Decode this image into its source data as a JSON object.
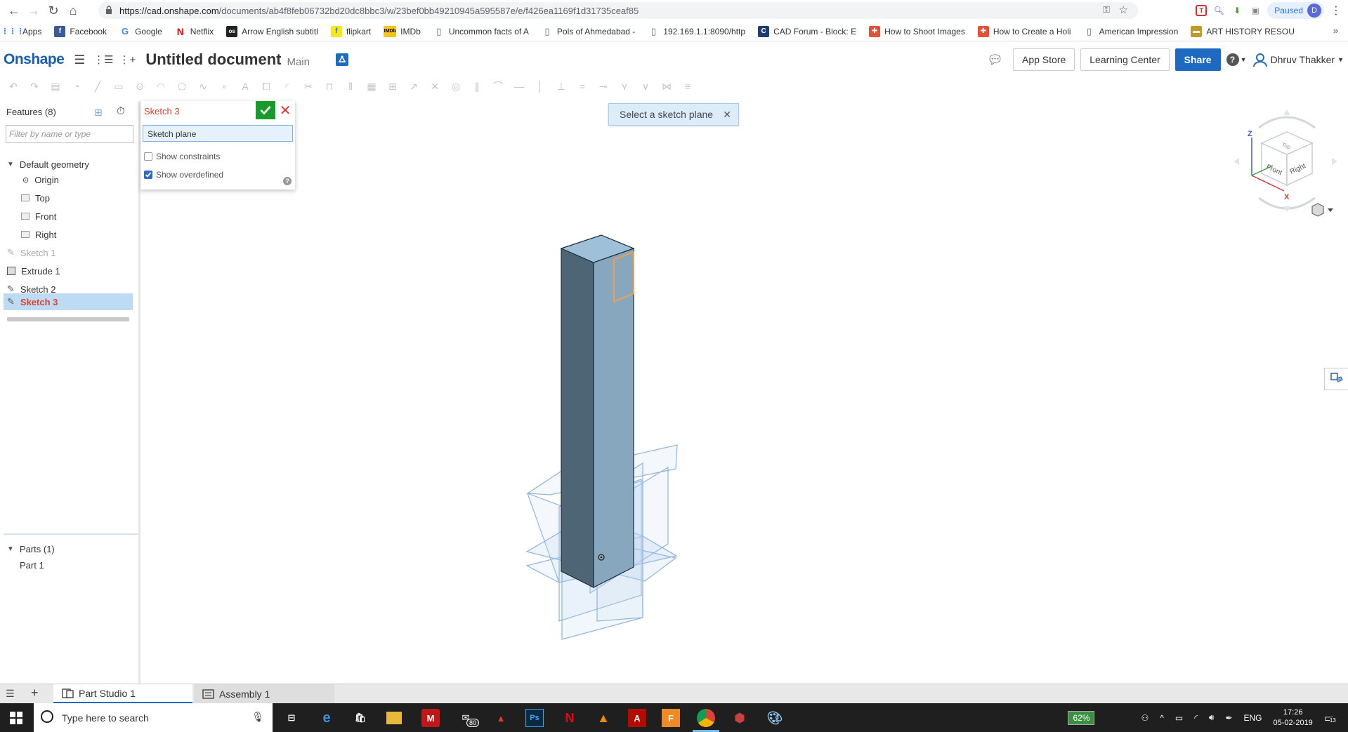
{
  "browser": {
    "url_host": "https://cad.onshape.com",
    "url_rest": "/documents/ab4f8feb06732bd20dc8bbc3/w/23bef0bb49210945a595587e/e/f426ea1169f1d31735ceaf85",
    "paused_label": "Paused",
    "profile_initial": "D"
  },
  "bookmarks": [
    {
      "label": "Apps",
      "color": "#4285f4",
      "glyph": "⋮⋮"
    },
    {
      "label": "Facebook",
      "color": "#3b5998",
      "glyph": "f"
    },
    {
      "label": "Google",
      "color": "#ffffff",
      "glyph": "G"
    },
    {
      "label": "Netflix",
      "color": "#e50914",
      "glyph": "N"
    },
    {
      "label": "Arrow English subtitl",
      "color": "#222222",
      "glyph": "os"
    },
    {
      "label": "flipkart",
      "color": "#f8e71c",
      "glyph": "f"
    },
    {
      "label": "IMDb",
      "color": "#f5c518",
      "glyph": "IMDb"
    },
    {
      "label": "Uncommon facts of A",
      "color": "#ffffff",
      "glyph": "▯"
    },
    {
      "label": "Pols of Ahmedabad -",
      "color": "#ffffff",
      "glyph": "▯"
    },
    {
      "label": "192.169.1.1:8090/http",
      "color": "#ffffff",
      "glyph": "▯"
    },
    {
      "label": "CAD Forum - Block: E",
      "color": "#1f3b73",
      "glyph": "C"
    },
    {
      "label": "How to Shoot Images",
      "color": "#e0533a",
      "glyph": "✚"
    },
    {
      "label": "How to Create a Holi",
      "color": "#e0533a",
      "glyph": "✚"
    },
    {
      "label": "American Impression",
      "color": "#ffffff",
      "glyph": "▯"
    },
    {
      "label": "ART HISTORY RESOU",
      "color": "#c39a2a",
      "glyph": "▬"
    }
  ],
  "header": {
    "logo": "Onshape",
    "doc_title": "Untitled document",
    "branch": "Main",
    "app_store": "App Store",
    "learning_center": "Learning Center",
    "share": "Share",
    "help": "?",
    "user": "Dhruv Thakker"
  },
  "features": {
    "heading": "Features (8)",
    "filter_placeholder": "Filter by name or type",
    "default_geometry": "Default geometry",
    "items": [
      {
        "label": "Origin",
        "icon": "origin-icon"
      },
      {
        "label": "Top",
        "icon": "plane-icon"
      },
      {
        "label": "Front",
        "icon": "plane-icon"
      },
      {
        "label": "Right",
        "icon": "plane-icon"
      },
      {
        "label": "Sketch 1",
        "icon": "sketch-icon"
      },
      {
        "label": "Extrude 1",
        "icon": "extrude-icon"
      },
      {
        "label": "Sketch 2",
        "icon": "sketch-icon"
      },
      {
        "label": "Sketch 3",
        "icon": "sketch-icon"
      }
    ],
    "parts_heading": "Parts (1)",
    "part": "Part 1"
  },
  "dialog": {
    "title": "Sketch 3",
    "plane_field": "Sketch plane",
    "show_constraints": "Show constraints",
    "show_constraints_checked": false,
    "show_overdefined": "Show overdefined",
    "show_overdefined_checked": true
  },
  "toast": {
    "message": "Select a sketch plane"
  },
  "viewcube": {
    "front": "Front",
    "right": "Right",
    "top": "Top",
    "z": "Z",
    "x": "X"
  },
  "tabs": {
    "part_studio": "Part Studio 1",
    "assembly": "Assembly 1"
  },
  "taskbar": {
    "search_placeholder": "Type here to search",
    "mail_badge": "80",
    "battery": "62%",
    "language": "ENG",
    "time": "17:26",
    "date": "05-02-2019",
    "notifications": "13"
  },
  "colors": {
    "accent": "#1e6ac2",
    "sketch_active": "#d9432f",
    "confirm": "#1a9a2c"
  }
}
